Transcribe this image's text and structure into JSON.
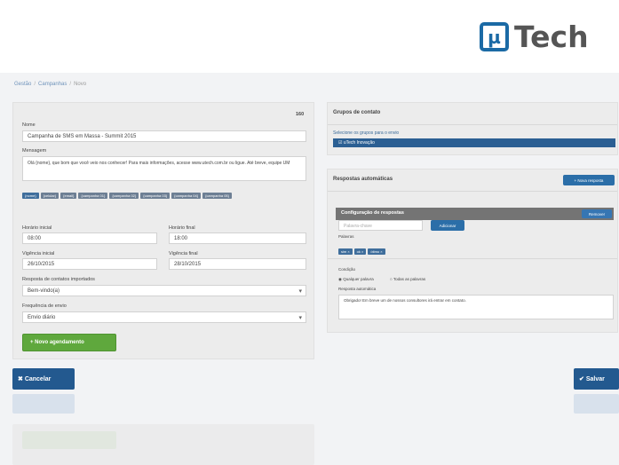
{
  "brand": {
    "logo_mark": "µ",
    "logo_text": "Tech"
  },
  "breadcrumb": [
    "Gestão",
    "Campanhas",
    "Novo"
  ],
  "form": {
    "char_counter": "160",
    "name_label": "Nome",
    "name_value": "Campanha de SMS em Massa - Summit 2015",
    "message_label": "Mensagem",
    "message_value": "Olá {nome}, que bom que você veio nos conhecer! Para mais informações, acesse www.utech.com.br ou ligue. Até breve, equipe UM",
    "tags": [
      "{nome}",
      "{celular}",
      "{email}",
      "{campanha 01}",
      "{campanha 02}",
      "{campanha 03}",
      "{campanha 04}",
      "{campanha 05}"
    ],
    "start_time_label": "Horário inicial",
    "start_time_value": "08:00",
    "end_time_label": "Horário final",
    "end_time_value": "18:00",
    "start_date_label": "Vigência inicial",
    "start_date_value": "26/10/2015",
    "end_date_label": "Vigência final",
    "end_date_value": "28/10/2015",
    "response_label": "Resposta de contatos importados",
    "response_value": "Bem-vindo(a)",
    "frequency_label": "Frequência de envio",
    "frequency_value": "Envio diário",
    "add_schedule_label": "+ Novo agendamento"
  },
  "contacts": {
    "title": "Grupos de contato",
    "select_label": "Selecione os grupos para o envio",
    "selected_group": "uTech Inovação"
  },
  "auto_responses": {
    "title": "Respostas automáticas",
    "new_button": "+ Nova resposta",
    "config_title": "Configuração de respostas",
    "remove_button": "Remover",
    "keyword_placeholder": "Palavra-chave",
    "add_button": "Adicionar",
    "keywords_label": "Palavras",
    "keywords": [
      "sim ×",
      "ok ×",
      "ótimo ×"
    ],
    "condition_label": "Condição",
    "condition_options": [
      "Qualquer palavra",
      "Todas as palavras"
    ],
    "reply_label": "Resposta automática",
    "reply_value": "Obrigado! Em breve um de nossos consultores irá entrar em contato."
  },
  "actions": {
    "cancel_label": "Cancelar",
    "save_label": "Salvar"
  },
  "colors": {
    "primary": "#23598f",
    "success": "#5fa83d",
    "muted": "#747474"
  }
}
